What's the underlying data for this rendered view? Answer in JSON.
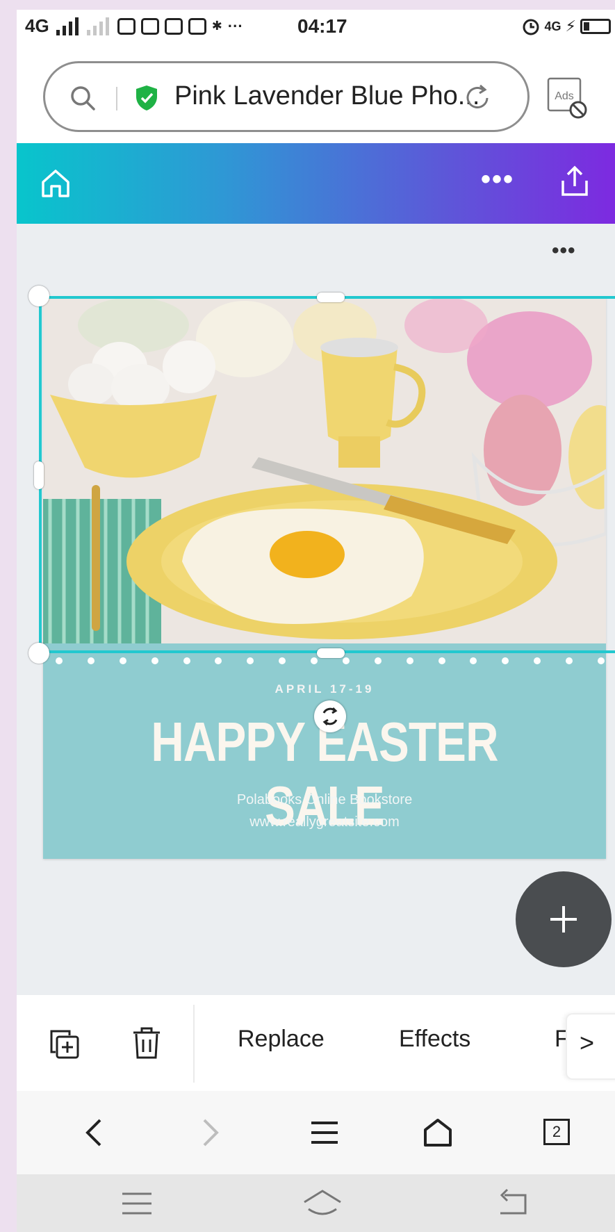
{
  "status_bar": {
    "network": "4G",
    "time": "04:17",
    "network_right": "4G"
  },
  "browser": {
    "url_text": "Pink Lavender Blue Pho...",
    "ads_label": "Ads",
    "tab_count": "2"
  },
  "editor": {
    "header_menu": "•••",
    "page_menu": "•••"
  },
  "design": {
    "date": "APRIL 17-19",
    "title": "HAPPY EASTER SALE",
    "subtitle": "Polabooks Online Bookstore",
    "website": "www.reallygreatsite.com"
  },
  "toolbar": {
    "replace_label": "Replace",
    "effects_label": "Effects",
    "filter_label": "Filter",
    "more_label": ">"
  },
  "colors": {
    "header_gradient_start": "#08c5cc",
    "header_gradient_end": "#7d2ae0",
    "selection": "#22c8cf",
    "banner": "#8fccd0",
    "fab": "#4a4d50"
  },
  "icons": [
    "search-icon",
    "shield-icon",
    "reload-icon",
    "ads-block-icon",
    "home-icon",
    "share-icon",
    "duplicate-icon",
    "trash-icon",
    "add-icon",
    "rotate-icon",
    "back-icon",
    "forward-icon",
    "menu-icon",
    "browser-home-icon"
  ]
}
